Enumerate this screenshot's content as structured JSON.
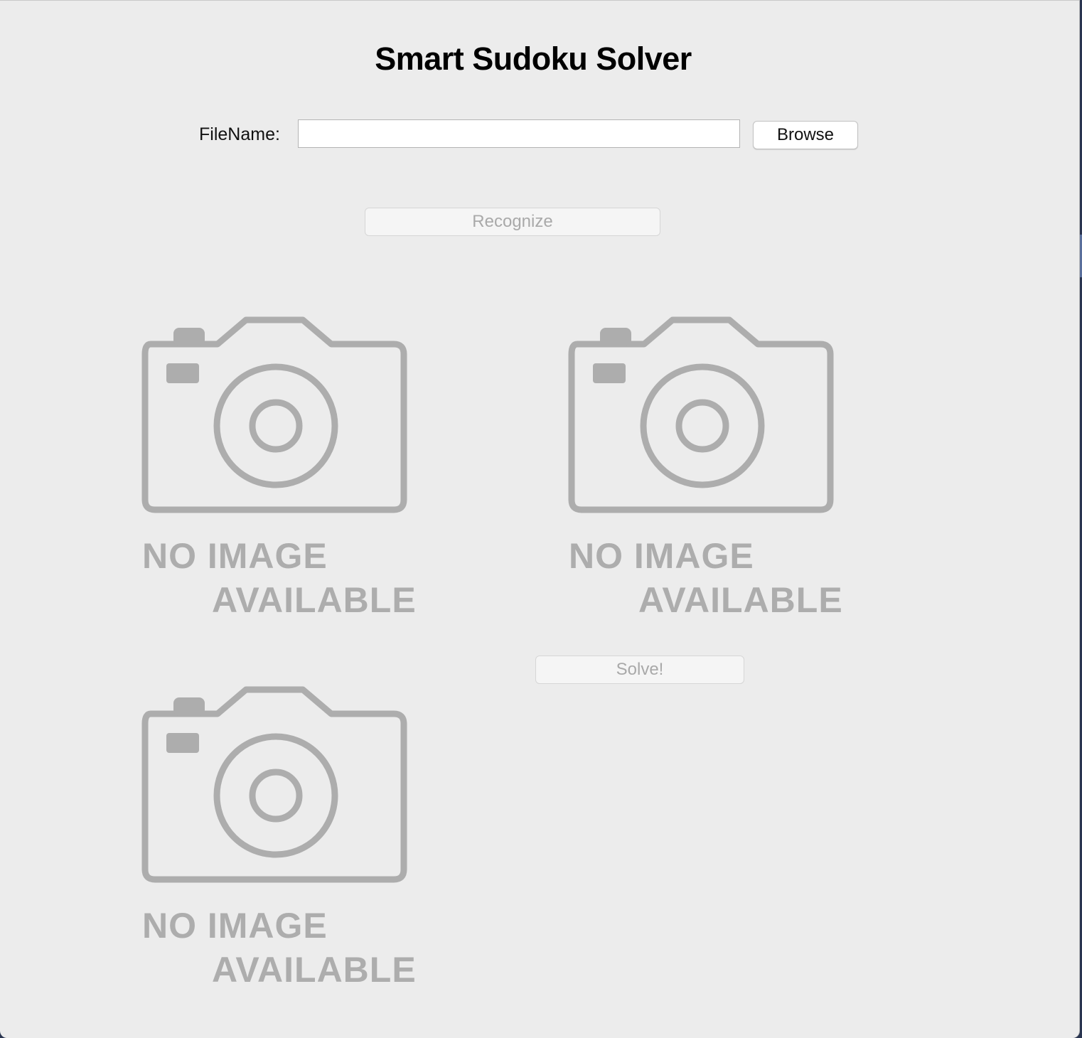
{
  "app": {
    "title": "Smart Sudoku Solver"
  },
  "file": {
    "label": "FileName:",
    "value": "",
    "placeholder": "",
    "browse_label": "Browse"
  },
  "actions": {
    "recognize_label": "Recognize",
    "recognize_enabled": false,
    "solve_label": "Solve!",
    "solve_enabled": false
  },
  "images": [
    {
      "icon": "camera-icon",
      "line1": "NO IMAGE",
      "line2": "AVAILABLE"
    },
    {
      "icon": "camera-icon",
      "line1": "NO IMAGE",
      "line2": "AVAILABLE"
    },
    {
      "icon": "camera-icon",
      "line1": "NO IMAGE",
      "line2": "AVAILABLE"
    }
  ],
  "colors": {
    "window_bg": "#ececec",
    "placeholder_gray": "#adadad",
    "disabled_text": "#a9a9a9"
  }
}
